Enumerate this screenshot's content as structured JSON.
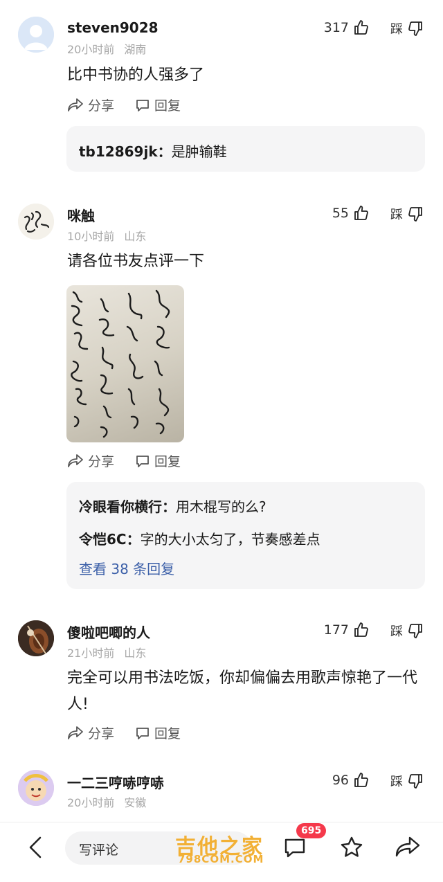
{
  "colors": {
    "link": "#3b5fa8",
    "badge": "#f5394b",
    "watermark": "#f2b035",
    "meta": "#a6a6a6"
  },
  "actions": {
    "share": "分享",
    "reply": "回复",
    "dislike": "踩"
  },
  "comments": [
    {
      "user": "steven9028",
      "time": "20小时前",
      "location": "湖南",
      "likes": "317",
      "text": "比中书协的人强多了",
      "replies": [
        {
          "user": "tb12869jk：",
          "text": "是肿输鞋"
        }
      ]
    },
    {
      "user": "咪触",
      "time": "10小时前",
      "location": "山东",
      "likes": "55",
      "text": "请各位书友点评一下",
      "replies": [
        {
          "user": "冷眼看你横行：",
          "text": "用木棍写的么?"
        },
        {
          "user": "令恺6C：",
          "text": "字的大小太匀了，节奏感差点"
        }
      ],
      "view_more": "查看 38 条回复"
    },
    {
      "user": "傻啦吧唧的人",
      "time": "21小时前",
      "location": "山东",
      "likes": "177",
      "text": "完全可以用书法吃饭，你却偏偏去用歌声惊艳了一代人!"
    },
    {
      "user": "一二三哼哧哼哧",
      "time": "20小时前",
      "location": "安徽",
      "likes": "96"
    }
  ],
  "bottom_bar": {
    "input_placeholder": "写评论",
    "comment_count": "695",
    "watermark_main": "吉他之家",
    "watermark_sub": "798COM.COM"
  }
}
